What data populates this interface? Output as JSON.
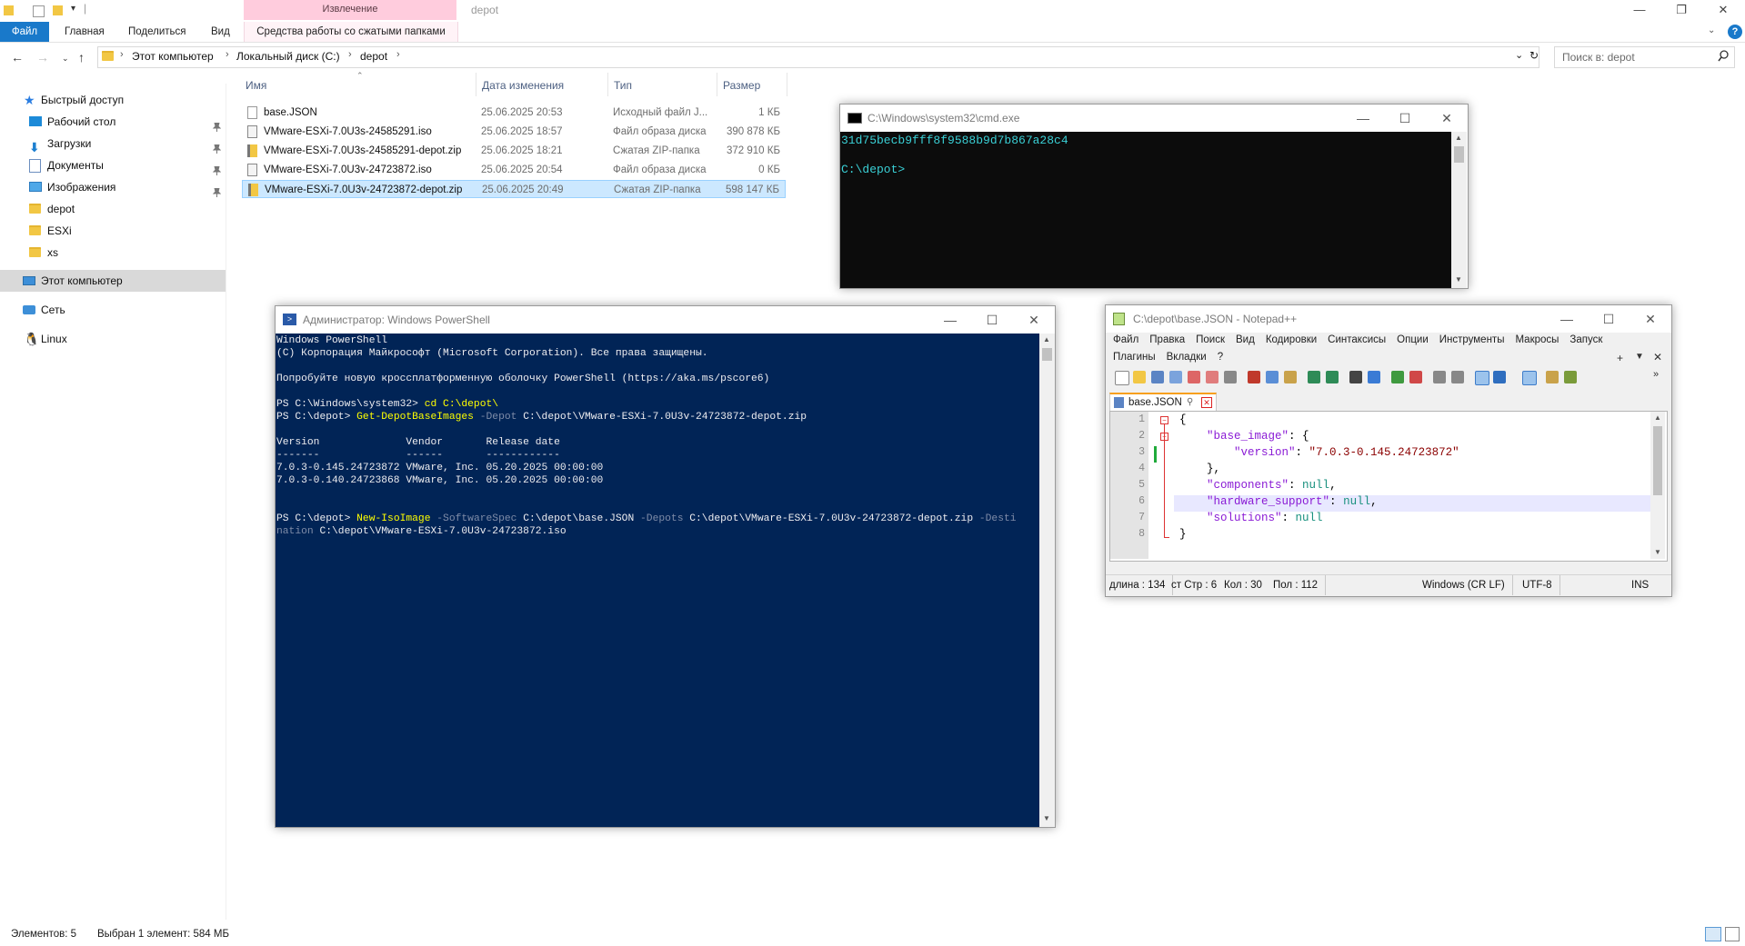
{
  "explorer": {
    "ribbon_context_header": "Извлечение",
    "window_title": "depot",
    "tabs": {
      "file": "Файл",
      "home": "Главная",
      "share": "Поделиться",
      "view": "Вид",
      "context": "Средства работы со сжатыми папками"
    },
    "breadcrumbs": [
      "Этот компьютер",
      "Локальный диск (C:)",
      "depot"
    ],
    "search": {
      "placeholder": "Поиск в: depot"
    },
    "nav": {
      "quick_access": "Быстрый доступ",
      "desktop": "Рабочий стол",
      "downloads": "Загрузки",
      "documents": "Документы",
      "pictures": "Изображения",
      "depot": "depot",
      "esxi": "ESXi",
      "xs": "xs",
      "this_pc": "Этот компьютер",
      "network": "Сеть",
      "linux": "Linux"
    },
    "columns": {
      "name": "Имя",
      "date": "Дата изменения",
      "type": "Тип",
      "size": "Размер"
    },
    "files": [
      {
        "name": "base.JSON",
        "date": "25.06.2025 20:53",
        "type": "Исходный файл J...",
        "size": "1 КБ"
      },
      {
        "name": "VMware-ESXi-7.0U3s-24585291.iso",
        "date": "25.06.2025 18:57",
        "type": "Файл образа диска",
        "size": "390 878 КБ"
      },
      {
        "name": "VMware-ESXi-7.0U3s-24585291-depot.zip",
        "date": "25.06.2025 18:21",
        "type": "Сжатая ZIP-папка",
        "size": "372 910 КБ"
      },
      {
        "name": "VMware-ESXi-7.0U3v-24723872.iso",
        "date": "25.06.2025 20:54",
        "type": "Файл образа диска",
        "size": "0 КБ"
      },
      {
        "name": "VMware-ESXi-7.0U3v-24723872-depot.zip",
        "date": "25.06.2025 20:49",
        "type": "Сжатая ZIP-папка",
        "size": "598 147 КБ"
      }
    ],
    "status": {
      "count": "Элементов: 5",
      "selected": "Выбран 1 элемент: 584 МБ"
    }
  },
  "cmd": {
    "title": "C:\\Windows\\system32\\cmd.exe",
    "line1": "31d75becb9fff8f9588b9d7b867a28c4",
    "line2": "C:\\depot>"
  },
  "powershell": {
    "title": "Администратор: Windows PowerShell",
    "banner1": "Windows PowerShell",
    "banner2": "(C) Корпорация Майкрософт (Microsoft Corporation). Все права защищены.",
    "banner3": "Попробуйте новую кроссплатформенную оболочку PowerShell (https://aka.ms/pscore6)",
    "cmd1_prompt": "PS C:\\Windows\\system32> ",
    "cmd1": "cd C:\\depot\\",
    "cmd2_prompt": "PS C:\\depot> ",
    "cmd2_name": "Get-DepotBaseImages",
    "cmd2_param": " -Depot",
    "cmd2_value": " C:\\depot\\VMware-ESXi-7.0U3v-24723872-depot.zip",
    "table_header": "Version              Vendor       Release date",
    "table_rule": "-------              ------       ------------",
    "row1": "7.0.3-0.145.24723872 VMware, Inc. 05.20.2025 00:00:00",
    "row2": "7.0.3-0.140.24723868 VMware, Inc. 05.20.2025 00:00:00",
    "cmd3_prompt": "PS C:\\depot> ",
    "cmd3_name": "New-IsoImage",
    "cmd3_p1": " -SoftwareSpec",
    "cmd3_v1": " C:\\depot\\base.JSON",
    "cmd3_p2": " -Depots",
    "cmd3_v2": " C:\\depot\\VMware-ESXi-7.0U3v-24723872-depot.zip",
    "cmd3_p3a": " -Desti",
    "cmd3_p3b": "nation",
    "cmd3_v3": " C:\\depot\\VMware-ESXi-7.0U3v-24723872.iso"
  },
  "notepadpp": {
    "title": "C:\\depot\\base.JSON - Notepad++",
    "menu1": [
      "Файл",
      "Правка",
      "Поиск",
      "Вид",
      "Кодировки",
      "Синтаксисы",
      "Опции",
      "Инструменты",
      "Макросы",
      "Запуск"
    ],
    "menu2": [
      "Плагины",
      "Вкладки",
      "?"
    ],
    "tab": "base.JSON",
    "line_numbers": [
      "1",
      "2",
      "3",
      "4",
      "5",
      "6",
      "7",
      "8"
    ],
    "code": {
      "l1": "{",
      "l2_key": "\"base_image\"",
      "l2_rest": ": {",
      "l3_key": "\"version\"",
      "l3_sep": ": ",
      "l3_val": "\"7.0.3-0.145.24723872\"",
      "l4": "},",
      "l5_key": "\"components\"",
      "l5_sep": ": ",
      "l5_val": "null",
      "l5_end": ",",
      "l6_key": "\"hardware_support\"",
      "l6_sep": ": ",
      "l6_val": "null",
      "l6_end": ",",
      "l7_key": "\"solutions\"",
      "l7_sep": ": ",
      "l7_val": "null",
      "l8": "}"
    },
    "status": {
      "length": "длина : 134",
      "position": "ст Стр : 6",
      "column": "Кол : 30",
      "pos": "Пол : 112",
      "eol": "Windows (CR LF)",
      "encoding": "UTF-8",
      "mode": "INS"
    }
  },
  "colors": {
    "accent": "#1979ca",
    "ps_bg": "#012456",
    "cmd_bg": "#0c0c0c",
    "selection": "#cce8ff",
    "context_tab": "#ffccdd"
  }
}
